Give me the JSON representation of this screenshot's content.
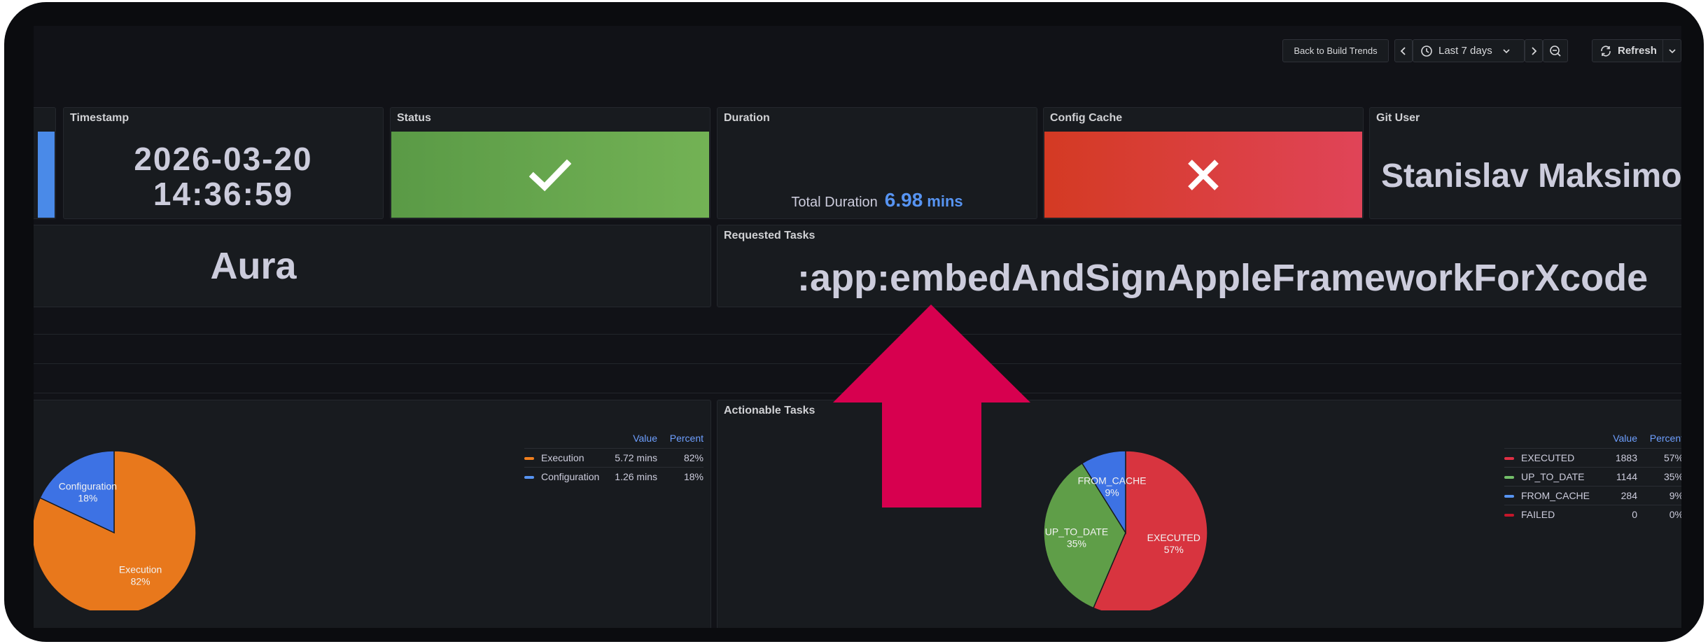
{
  "toolbar": {
    "back_label": "Back to Build Trends",
    "time_range": "Last 7 days",
    "refresh_label": "Refresh"
  },
  "timestamp": {
    "title": "Timestamp",
    "date": "2026-03-20",
    "time": "14:36:59"
  },
  "status": {
    "title": "Status",
    "color_from": "#5a9a46",
    "color_to": "#73b255"
  },
  "duration": {
    "title": "Duration",
    "label": "Total Duration",
    "value": "6.98",
    "unit": "mins",
    "value_color": "#5794f2"
  },
  "config_cache": {
    "title": "Config Cache",
    "color_from": "#d43a23",
    "color_to": "#e04458"
  },
  "git_user": {
    "title": "Git User",
    "value": "Stanislav Maksimov"
  },
  "project": {
    "value": "Aura"
  },
  "requested_tasks": {
    "title": "Requested Tasks",
    "value": ":app:embedAndSignAppleFrameworkForXcode"
  },
  "left_pie": {
    "legend_headers": [
      "Value",
      "Percent"
    ],
    "legend": [
      {
        "name": "Execution",
        "value": "5.72 mins",
        "percent": "82%",
        "color": "#f07f1e"
      },
      {
        "name": "Configuration",
        "value": "1.26 mins",
        "percent": "18%",
        "color": "#5794f2"
      }
    ]
  },
  "actionable_tasks": {
    "title": "Actionable Tasks",
    "legend_headers": [
      "Value",
      "Percent"
    ],
    "legend": [
      {
        "name": "EXECUTED",
        "value": "1883",
        "percent": "57%",
        "color": "#e02f44"
      },
      {
        "name": "UP_TO_DATE",
        "value": "1144",
        "percent": "35%",
        "color": "#73bf69"
      },
      {
        "name": "FROM_CACHE",
        "value": "284",
        "percent": "9%",
        "color": "#5794f2"
      },
      {
        "name": "FAILED",
        "value": "0",
        "percent": "0%",
        "color": "#c4162a"
      }
    ]
  },
  "chart_data": [
    {
      "type": "pie",
      "categories": [
        "Execution",
        "Configuration"
      ],
      "values": [
        82,
        18
      ],
      "labels": [
        "82%",
        "18%"
      ],
      "colors": [
        "#e8781c",
        "#3d72e4"
      ]
    },
    {
      "type": "pie",
      "categories": [
        "EXECUTED",
        "UP_TO_DATE",
        "FROM_CACHE"
      ],
      "values": [
        57,
        35,
        9
      ],
      "labels": [
        "57%",
        "35%",
        "9%"
      ],
      "colors": [
        "#d8343f",
        "#5f9e48",
        "#3d72e4"
      ]
    }
  ],
  "annotation": {
    "arrow_color": "#d7004f"
  }
}
